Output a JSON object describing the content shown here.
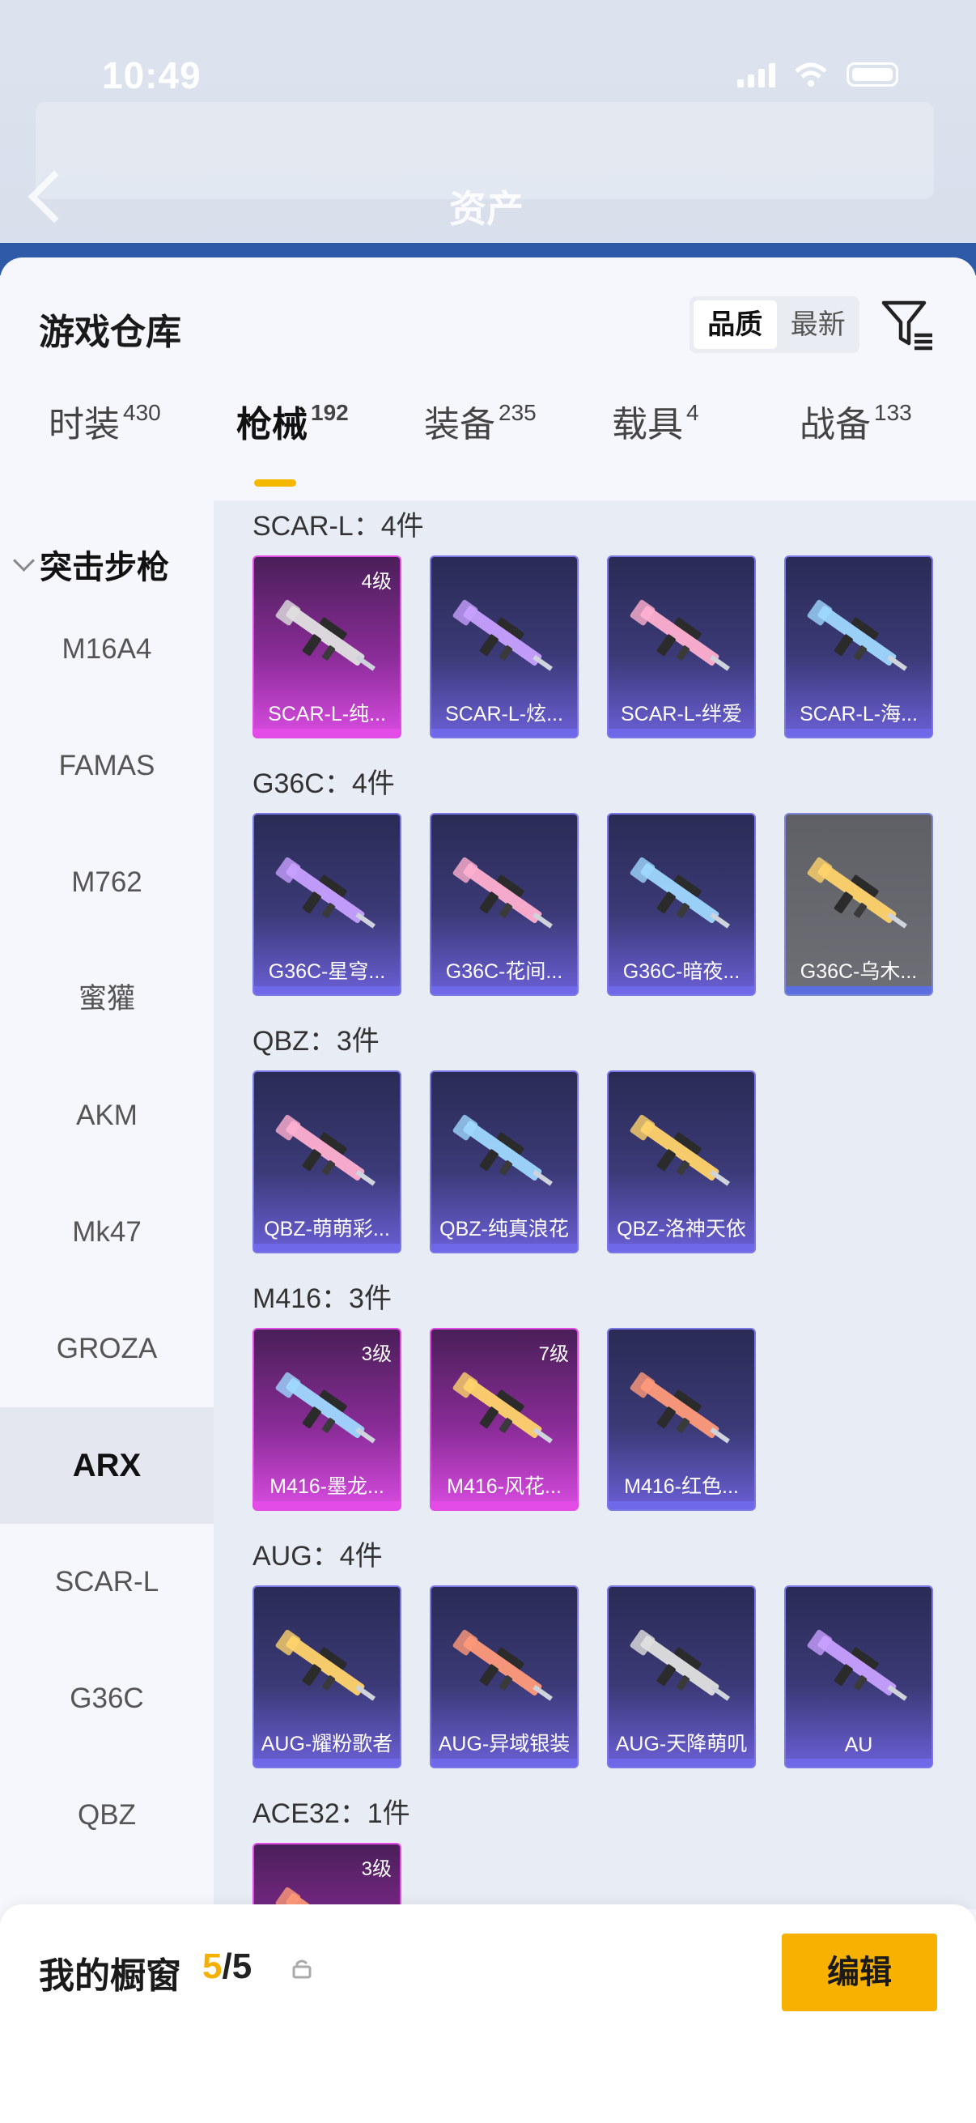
{
  "status": {
    "time": "10:49"
  },
  "background": {
    "asset_title": "资产"
  },
  "sheet": {
    "title": "游戏仓库",
    "sort": {
      "quality": "品质",
      "latest": "最新"
    }
  },
  "tabs": [
    {
      "label": "时装",
      "count": "430"
    },
    {
      "label": "枪械",
      "count": "192"
    },
    {
      "label": "装备",
      "count": "235"
    },
    {
      "label": "载具",
      "count": "4"
    },
    {
      "label": "战备",
      "count": "133"
    }
  ],
  "sidebar": {
    "header": "突击步枪",
    "items": [
      "M16A4",
      "FAMAS",
      "M762",
      "蜜獾",
      "AKM",
      "Mk47",
      "GROZA",
      "ARX",
      "SCAR-L",
      "G36C",
      "QBZ"
    ],
    "active": "ARX"
  },
  "groups": [
    {
      "title": "SCAR-L：4件",
      "items": [
        {
          "name": "SCAR-L-纯...",
          "level": "4级",
          "rarity": "pink"
        },
        {
          "name": "SCAR-L-炫...",
          "level": "",
          "rarity": "purple"
        },
        {
          "name": "SCAR-L-绊爱",
          "level": "",
          "rarity": "purple"
        },
        {
          "name": "SCAR-L-海...",
          "level": "",
          "rarity": "purple"
        }
      ]
    },
    {
      "title": "G36C：4件",
      "items": [
        {
          "name": "G36C-星穹...",
          "level": "",
          "rarity": "purple"
        },
        {
          "name": "G36C-花间...",
          "level": "",
          "rarity": "purple"
        },
        {
          "name": "G36C-暗夜...",
          "level": "",
          "rarity": "purple"
        },
        {
          "name": "G36C-乌木...",
          "level": "",
          "rarity": "gray"
        }
      ]
    },
    {
      "title": "QBZ：3件",
      "items": [
        {
          "name": "QBZ-萌萌彩...",
          "level": "",
          "rarity": "purple"
        },
        {
          "name": "QBZ-纯真浪花",
          "level": "",
          "rarity": "purple"
        },
        {
          "name": "QBZ-洛神天依",
          "level": "",
          "rarity": "purple"
        }
      ]
    },
    {
      "title": "M416：3件",
      "items": [
        {
          "name": "M416-墨龙...",
          "level": "3级",
          "rarity": "pink"
        },
        {
          "name": "M416-风花...",
          "level": "7级",
          "rarity": "pink"
        },
        {
          "name": "M416-红色...",
          "level": "",
          "rarity": "purple"
        }
      ]
    },
    {
      "title": "AUG：4件",
      "items": [
        {
          "name": "AUG-耀粉歌者",
          "level": "",
          "rarity": "purple"
        },
        {
          "name": "AUG-异域银装",
          "level": "",
          "rarity": "purple"
        },
        {
          "name": "AUG-天降萌叽",
          "level": "",
          "rarity": "purple"
        },
        {
          "name": "AU",
          "level": "",
          "rarity": "purple"
        }
      ]
    },
    {
      "title": "ACE32：1件",
      "items": [
        {
          "name": "",
          "level": "3级",
          "rarity": "pink"
        }
      ]
    }
  ],
  "colors": {
    "accent": "#f7b100",
    "epic": "#e44ce8",
    "rare": "#6f68e8"
  },
  "bottom": {
    "title": "我的橱窗",
    "current": "5",
    "separator": "/",
    "total": "5",
    "edit_label": "编辑"
  },
  "icons": {
    "filter": "filter-icon",
    "share": "share-icon",
    "lock": "lock-icon",
    "back": "back-icon"
  }
}
